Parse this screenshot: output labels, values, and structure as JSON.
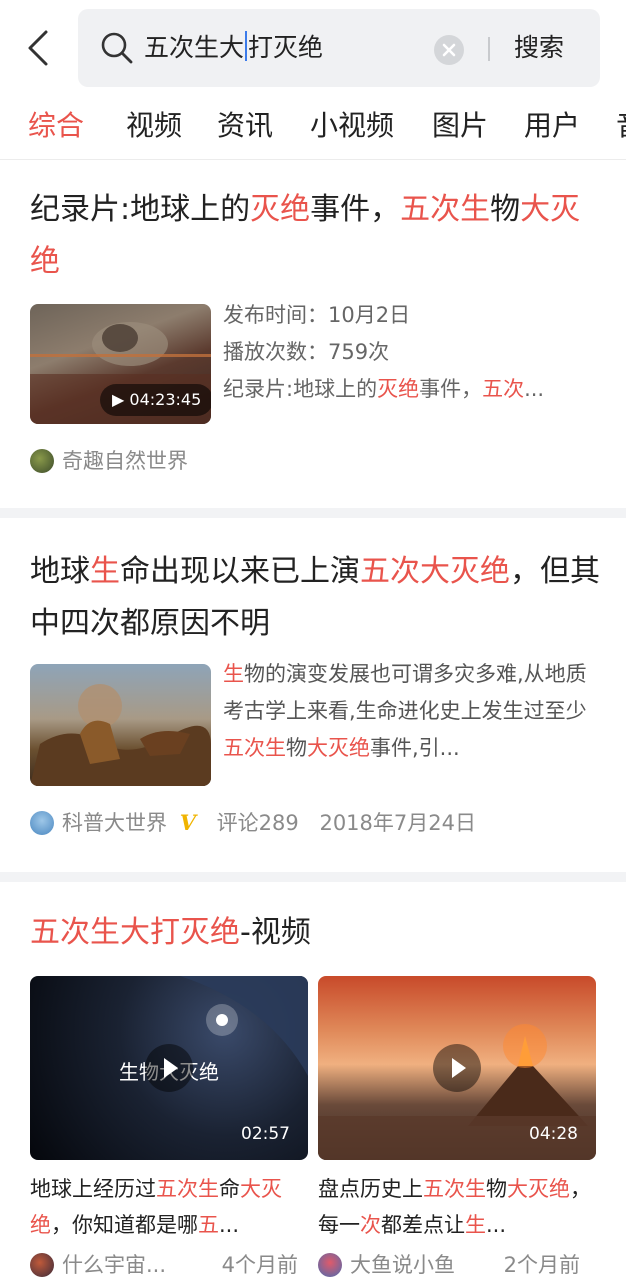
{
  "search": {
    "query_before_caret": "五次生大",
    "query_after_caret": "打灭绝",
    "button_label": "搜索"
  },
  "tabs": [
    "综合",
    "视频",
    "资讯",
    "小视频",
    "图片",
    "用户",
    "音"
  ],
  "card1": {
    "title_segments": [
      {
        "t": "纪录片:地球上的",
        "h": false
      },
      {
        "t": "灭绝",
        "h": true
      },
      {
        "t": "事件，",
        "h": false
      },
      {
        "t": "五次生",
        "h": true
      },
      {
        "t": "物",
        "h": false
      },
      {
        "t": "大灭绝",
        "h": true
      }
    ],
    "duration": "04:23:45",
    "publish_time": "发布时间：10月2日",
    "play_count": "播放次数：759次",
    "desc_segments": [
      {
        "t": "纪录片:地球上的",
        "h": false
      },
      {
        "t": "灭绝",
        "h": true
      },
      {
        "t": "事件，",
        "h": false
      },
      {
        "t": "五次",
        "h": true
      },
      {
        "t": "...",
        "h": false
      }
    ],
    "source": "奇趣自然世界"
  },
  "card2": {
    "title_segments": [
      {
        "t": "地球",
        "h": false
      },
      {
        "t": "生",
        "h": true
      },
      {
        "t": "命出现以来已上演",
        "h": false
      },
      {
        "t": "五次大灭绝",
        "h": true
      },
      {
        "t": "，但其中四次都原因不明",
        "h": false
      }
    ],
    "desc_segments": [
      {
        "t": "生",
        "h": true
      },
      {
        "t": "物的演变发展也可谓多灾多难,从地质考古学上来看,生命进化史上发生过至少",
        "h": false
      },
      {
        "t": "五次生",
        "h": true
      },
      {
        "t": "物",
        "h": false
      },
      {
        "t": "大灭绝",
        "h": true
      },
      {
        "t": "事件,引...",
        "h": false
      }
    ],
    "source": "科普大世界",
    "verified_mark": "V",
    "comments": "评论289",
    "date": "2018年7月24日"
  },
  "card3": {
    "heading_highlight": "五次生大打灭绝",
    "heading_suffix": "-视频",
    "videos": [
      {
        "overlay_text": "生物大灭绝",
        "duration": "02:57",
        "title_segments": [
          {
            "t": "地球上经历过",
            "h": false
          },
          {
            "t": "五次生",
            "h": true
          },
          {
            "t": "命",
            "h": false
          },
          {
            "t": "大灭绝",
            "h": true
          },
          {
            "t": "，你知道都是哪",
            "h": false
          },
          {
            "t": "五",
            "h": true
          },
          {
            "t": "...",
            "h": false
          }
        ],
        "author": "什么宇宙...",
        "time": "4个月前"
      },
      {
        "overlay_text": "",
        "duration": "04:28",
        "title_segments": [
          {
            "t": "盘点历史上",
            "h": false
          },
          {
            "t": "五次生",
            "h": true
          },
          {
            "t": "物",
            "h": false
          },
          {
            "t": "大灭绝",
            "h": true
          },
          {
            "t": "，每一",
            "h": false
          },
          {
            "t": "次",
            "h": true
          },
          {
            "t": "都差点让",
            "h": false
          },
          {
            "t": "生",
            "h": true
          },
          {
            "t": "...",
            "h": false
          }
        ],
        "author": "大鱼说小鱼",
        "time": "2个月前"
      }
    ]
  },
  "colors": {
    "highlight": "#e9544c",
    "tab_active": "#e9544c",
    "verified": "#f0b400",
    "search_bg": "#f0f1f3",
    "caret": "#3b7bea"
  }
}
